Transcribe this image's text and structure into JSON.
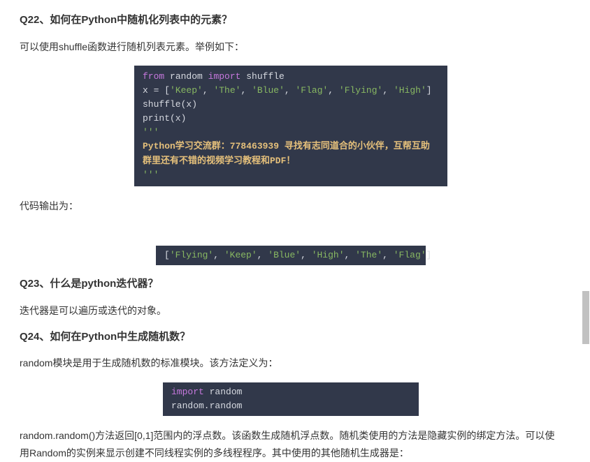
{
  "q22": {
    "heading": "Q22、如何在Python中随机化列表中的元素？",
    "intro": "可以使用shuffle函数进行随机列表元素。举例如下：",
    "code": {
      "from": "from",
      "module": " random ",
      "import": "import",
      "name": " shuffle",
      "line2a": "x = [",
      "s1": "'Keep'",
      "c": ", ",
      "s2": "'The'",
      "s3": "'Blue'",
      "s4": "'Flag'",
      "s5": "'Flying'",
      "s6": "'High'",
      "line2b": "]",
      "line3": "shuffle(x)",
      "line4": "print(x)",
      "triple1": "'''",
      "yellow1": "Python学习交流群：778463939 寻找有志同道合的小伙伴，互帮互助",
      "yellow2": "群里还有不错的视频学习教程和PDF！",
      "triple2": "'''"
    },
    "output_label": "代码输出为：",
    "output": {
      "open": "[",
      "o1": "'Flying'",
      "c": ", ",
      "o2": "'Keep'",
      "o3": "'Blue'",
      "o4": "'High'",
      "o5": "'The'",
      "o6": "'Flag'",
      "close": "]"
    }
  },
  "q23": {
    "heading": "Q23、什么是python迭代器？",
    "body": "迭代器是可以遍历或迭代的对象。"
  },
  "q24": {
    "heading": "Q24、如何在Python中生成随机数？",
    "intro": "random模块是用于生成随机数的标准模块。该方法定义为：",
    "code": {
      "import": "import",
      "module": " random",
      "line2": "random.random"
    },
    "body2": "random.random()方法返回[0,1]范围内的浮点数。该函数生成随机浮点数。随机类使用的方法是隐藏实例的绑定方法。可以使用Random的实例来显示创建不同线程实例的多线程程序。其中使用的其他随机生成器是："
  }
}
